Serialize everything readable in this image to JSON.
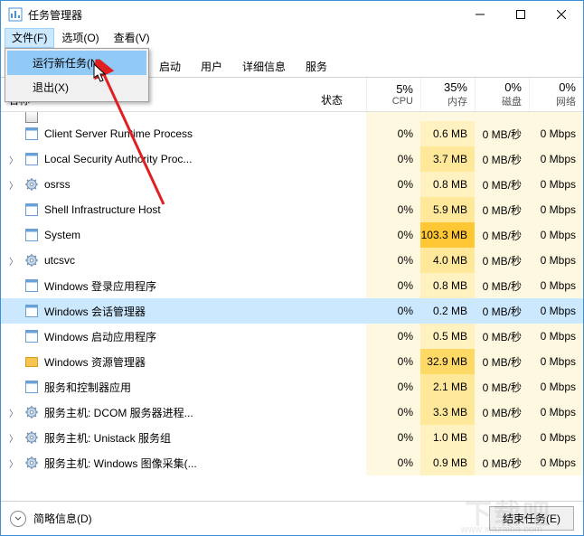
{
  "window": {
    "title": "任务管理器"
  },
  "menubar": {
    "file": "文件(F)",
    "options": "选项(O)",
    "view": "查看(V)",
    "dropdown": {
      "run": "运行新任务(N)",
      "exit": "退出(X)"
    }
  },
  "tabs": {
    "startup": "启动",
    "users": "用户",
    "details": "详细信息",
    "services": "服务"
  },
  "columns": {
    "name": "名称",
    "status": "状态",
    "cpu": {
      "pct": "5%",
      "label": "CPU"
    },
    "mem": {
      "pct": "35%",
      "label": "内存"
    },
    "disk": {
      "pct": "0%",
      "label": "磁盘"
    },
    "net": {
      "pct": "0%",
      "label": "网络"
    }
  },
  "processes": [
    {
      "name": "Client Server Runtime Process",
      "expandable": false,
      "icon": "app",
      "cpu": "0%",
      "mem": "0.6 MB",
      "disk": "0 MB/秒",
      "net": "0 Mbps",
      "selected": false,
      "memClass": "bg-light"
    },
    {
      "name": "Local Security Authority Proc...",
      "expandable": true,
      "icon": "app",
      "cpu": "0%",
      "mem": "3.7 MB",
      "disk": "0 MB/秒",
      "net": "0 Mbps",
      "selected": false,
      "memClass": "bg-med"
    },
    {
      "name": "osrss",
      "expandable": true,
      "icon": "gear",
      "cpu": "0%",
      "mem": "0.8 MB",
      "disk": "0 MB/秒",
      "net": "0 Mbps",
      "selected": false,
      "memClass": "bg-light"
    },
    {
      "name": "Shell Infrastructure Host",
      "expandable": false,
      "icon": "app",
      "cpu": "0%",
      "mem": "5.9 MB",
      "disk": "0 MB/秒",
      "net": "0 Mbps",
      "selected": false,
      "memClass": "bg-med"
    },
    {
      "name": "System",
      "expandable": false,
      "icon": "app",
      "cpu": "0%",
      "mem": "103.3 MB",
      "disk": "0 MB/秒",
      "net": "0 Mbps",
      "selected": false,
      "memClass": "bg-vstrong"
    },
    {
      "name": "utcsvc",
      "expandable": true,
      "icon": "gear",
      "cpu": "0%",
      "mem": "4.0 MB",
      "disk": "0 MB/秒",
      "net": "0 Mbps",
      "selected": false,
      "memClass": "bg-med"
    },
    {
      "name": "Windows 登录应用程序",
      "expandable": false,
      "icon": "app",
      "cpu": "0%",
      "mem": "0.8 MB",
      "disk": "0 MB/秒",
      "net": "0 Mbps",
      "selected": false,
      "memClass": "bg-light"
    },
    {
      "name": "Windows 会话管理器",
      "expandable": false,
      "icon": "app",
      "cpu": "0%",
      "mem": "0.2 MB",
      "disk": "0 MB/秒",
      "net": "0 Mbps",
      "selected": true,
      "memClass": "bg-light"
    },
    {
      "name": "Windows 启动应用程序",
      "expandable": false,
      "icon": "app",
      "cpu": "0%",
      "mem": "0.5 MB",
      "disk": "0 MB/秒",
      "net": "0 Mbps",
      "selected": false,
      "memClass": "bg-light"
    },
    {
      "name": "Windows 资源管理器",
      "expandable": false,
      "icon": "folder",
      "cpu": "0%",
      "mem": "32.9 MB",
      "disk": "0 MB/秒",
      "net": "0 Mbps",
      "selected": false,
      "memClass": "bg-strong"
    },
    {
      "name": "服务和控制器应用",
      "expandable": false,
      "icon": "app",
      "cpu": "0%",
      "mem": "2.1 MB",
      "disk": "0 MB/秒",
      "net": "0 Mbps",
      "selected": false,
      "memClass": "bg-med"
    },
    {
      "name": "服务主机: DCOM 服务器进程...",
      "expandable": true,
      "icon": "gear",
      "cpu": "0%",
      "mem": "3.3 MB",
      "disk": "0 MB/秒",
      "net": "0 Mbps",
      "selected": false,
      "memClass": "bg-med"
    },
    {
      "name": "服务主机: Unistack 服务组",
      "expandable": true,
      "icon": "gear",
      "cpu": "0%",
      "mem": "1.0 MB",
      "disk": "0 MB/秒",
      "net": "0 Mbps",
      "selected": false,
      "memClass": "bg-light"
    },
    {
      "name": "服务主机: Windows 图像采集(...",
      "expandable": true,
      "icon": "gear",
      "cpu": "0%",
      "mem": "0.9 MB",
      "disk": "0 MB/秒",
      "net": "0 Mbps",
      "selected": false,
      "memClass": "bg-light"
    }
  ],
  "footer": {
    "fewer": "简略信息(D)",
    "end": "结束任务(E)"
  },
  "watermark": {
    "main": "下载吧",
    "sub": "www.xiazaiba.com"
  }
}
